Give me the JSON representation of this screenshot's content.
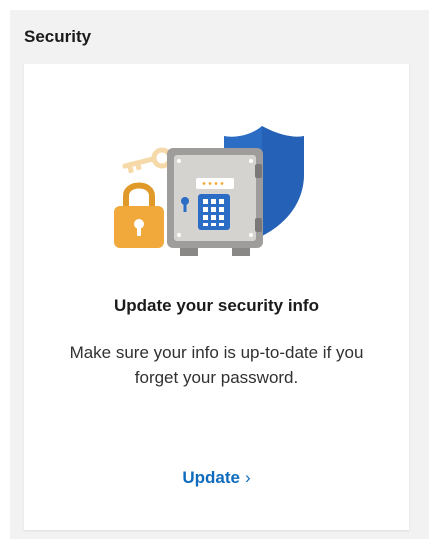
{
  "section": {
    "title": "Security"
  },
  "card": {
    "heading": "Update your security info",
    "description": "Make sure your info is up-to-date if you forget your password.",
    "action_label": "Update",
    "action_chevron": "›",
    "illustration_icon": "security-safe-illustration",
    "colors": {
      "link": "#0f6cbd",
      "shield": "#2b6cc4",
      "lock": "#f2a93b",
      "safe": "#8a8886",
      "keypad": "#2b6cc4"
    }
  }
}
